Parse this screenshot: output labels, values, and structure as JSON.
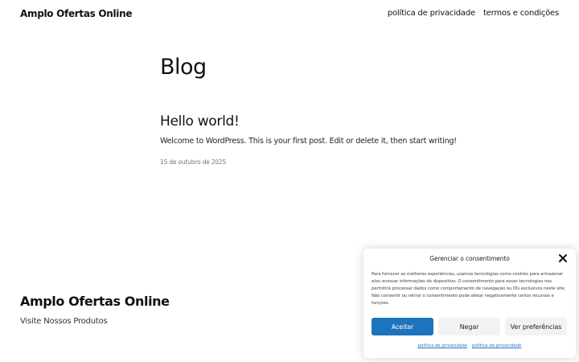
{
  "header": {
    "site_title": "Amplo Ofertas Online",
    "nav": [
      {
        "label": "política de privacidade"
      },
      {
        "label": "termos e condições"
      }
    ]
  },
  "main": {
    "page_title": "Blog",
    "posts": [
      {
        "title": "Hello world!",
        "excerpt": "Welcome to WordPress. This is your first post. Edit or delete it, then start writing!",
        "date": "15 de outubro de 2025"
      }
    ]
  },
  "footer": {
    "site_title": "Amplo Ofertas Online",
    "tagline": "Visite Nossos Produtos"
  },
  "consent": {
    "title": "Gerenciar o consentimento",
    "body": "Para fornecer as melhores experiências, usamos tecnologias como cookies para armazenar e/ou acessar informações do dispositivo. O consentimento para essas tecnologias nos permitirá processar dados como comportamento de navegação ou IDs exclusivos neste site. Não consentir ou retirar o consentimento pode afetar negativamente certos recursos e funções.",
    "accept_label": "Aceitar",
    "deny_label": "Negar",
    "prefs_label": "Ver preferências",
    "links": [
      {
        "label": "política de privacidade"
      },
      {
        "label": "política de privacidade"
      }
    ],
    "icons": {
      "close": "close-icon"
    },
    "colors": {
      "accent": "#1e73be"
    }
  }
}
